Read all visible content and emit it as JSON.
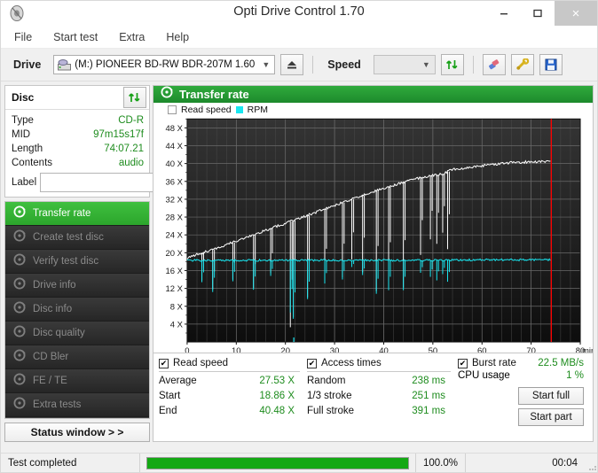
{
  "window": {
    "title": "Opti Drive Control 1.70",
    "app_icon": "disc-icon",
    "minimize": "–",
    "maximize": "□",
    "close": "×"
  },
  "menu": {
    "items": [
      {
        "label": "File"
      },
      {
        "label": "Start test"
      },
      {
        "label": "Extra"
      },
      {
        "label": "Help"
      }
    ]
  },
  "toolbar": {
    "drive_label": "Drive",
    "drive_value": "(M:)  PIONEER BD-RW   BDR-207M 1.60",
    "eject_icon": "eject-icon",
    "speed_label": "Speed",
    "speed_value": "",
    "refresh_icon": "refresh-arrows-icon",
    "eraser_icon": "eraser-icon",
    "tools_icon": "wrench-icon",
    "save_icon": "save-floppy-icon"
  },
  "disc": {
    "panel_title": "Disc",
    "refresh_icon": "refresh-arrows-icon",
    "rows": [
      {
        "key": "Type",
        "value": "CD-R"
      },
      {
        "key": "MID",
        "value": "97m15s17f"
      },
      {
        "key": "Length",
        "value": "74:07.21"
      },
      {
        "key": "Contents",
        "value": "audio"
      }
    ],
    "label_key": "Label",
    "label_value": "",
    "label_placeholder": "",
    "cd_icon": "cd-disc-icon"
  },
  "nav": {
    "items": [
      {
        "label": "Transfer rate",
        "icon": "disc-test-icon",
        "active": true
      },
      {
        "label": "Create test disc",
        "icon": "disc-test-icon",
        "active": false
      },
      {
        "label": "Verify test disc",
        "icon": "disc-test-icon",
        "active": false
      },
      {
        "label": "Drive info",
        "icon": "disc-test-icon",
        "active": false
      },
      {
        "label": "Disc info",
        "icon": "disc-test-icon",
        "active": false
      },
      {
        "label": "Disc quality",
        "icon": "disc-test-icon",
        "active": false
      },
      {
        "label": "CD Bler",
        "icon": "disc-test-icon",
        "active": false
      },
      {
        "label": "FE / TE",
        "icon": "disc-test-icon",
        "active": false
      },
      {
        "label": "Extra tests",
        "icon": "disc-test-icon",
        "active": false
      }
    ],
    "status_window_button": "Status window > >"
  },
  "chart_panel": {
    "header_title": "Transfer rate",
    "header_icon": "disc-test-icon"
  },
  "chart_data": {
    "type": "line",
    "title": "Transfer rate",
    "xlabel": "min",
    "ylabel": "X",
    "xlim": [
      0,
      80
    ],
    "ylim": [
      0,
      50
    ],
    "xticks": [
      0,
      10,
      20,
      30,
      40,
      50,
      60,
      70,
      80
    ],
    "xtick_labels": [
      "0",
      "10",
      "20",
      "30",
      "40",
      "50",
      "60",
      "70",
      "80"
    ],
    "x_unit_label": "min",
    "yticks": [
      4,
      8,
      12,
      16,
      20,
      24,
      28,
      32,
      36,
      40,
      44,
      48
    ],
    "ytick_labels": [
      "4 X",
      "8 X",
      "12 X",
      "16 X",
      "20 X",
      "24 X",
      "28 X",
      "32 X",
      "36 X",
      "40 X",
      "44 X",
      "48 X"
    ],
    "grid": true,
    "legend_position": "top-left",
    "plot_background": "#1a1a1a",
    "end_marker_x": 74.1,
    "end_marker_color": "#ff0000",
    "series": [
      {
        "name": "Read speed",
        "color": "#ffffff",
        "points": [
          [
            0.0,
            18.8
          ],
          [
            2.0,
            19.6
          ],
          [
            4.0,
            20.3
          ],
          [
            6.0,
            21.0
          ],
          [
            8.0,
            21.8
          ],
          [
            10.0,
            22.6
          ],
          [
            12.0,
            23.4
          ],
          [
            14.0,
            24.2
          ],
          [
            16.0,
            25.0
          ],
          [
            18.0,
            25.8
          ],
          [
            20.0,
            26.6
          ],
          [
            22.0,
            27.4
          ],
          [
            24.0,
            28.2
          ],
          [
            26.0,
            29.0
          ],
          [
            28.0,
            29.8
          ],
          [
            30.0,
            30.6
          ],
          [
            32.0,
            31.4
          ],
          [
            34.0,
            32.2
          ],
          [
            36.0,
            33.0
          ],
          [
            38.0,
            33.7
          ],
          [
            40.0,
            34.4
          ],
          [
            42.0,
            35.1
          ],
          [
            44.0,
            35.8
          ],
          [
            46.0,
            36.4
          ],
          [
            48.0,
            37.0
          ],
          [
            50.0,
            37.3
          ],
          [
            52.0,
            37.7
          ],
          [
            54.0,
            38.7
          ],
          [
            56.0,
            38.9
          ],
          [
            58.0,
            39.2
          ],
          [
            60.0,
            39.5
          ],
          [
            62.0,
            39.8
          ],
          [
            64.0,
            40.0
          ],
          [
            66.0,
            40.2
          ],
          [
            68.0,
            40.3
          ],
          [
            70.0,
            40.4
          ],
          [
            72.0,
            40.4
          ],
          [
            74.1,
            40.5
          ]
        ],
        "dropouts": [
          [
            3.0,
            13.8
          ],
          [
            5.2,
            11.8
          ],
          [
            9.3,
            14.0
          ],
          [
            13.5,
            12.1
          ],
          [
            17.0,
            15.4
          ],
          [
            21.0,
            3.3
          ],
          [
            21.6,
            5.6
          ],
          [
            24.5,
            10.0
          ],
          [
            28.0,
            13.6
          ],
          [
            31.6,
            14.5
          ],
          [
            33.5,
            18.5
          ],
          [
            35.7,
            15.6
          ],
          [
            38.5,
            11.4
          ],
          [
            41.0,
            12.2
          ],
          [
            44.0,
            12.2
          ],
          [
            47.5,
            19.5
          ],
          [
            49.5,
            23.0
          ],
          [
            50.8,
            22.0
          ],
          [
            52.0,
            24.5
          ],
          [
            53.0,
            20.8
          ]
        ]
      },
      {
        "name": "RPM",
        "color": "#19e6f0",
        "points": [
          [
            0.0,
            18.3
          ],
          [
            10.0,
            18.3
          ],
          [
            20.0,
            18.3
          ],
          [
            30.0,
            18.3
          ],
          [
            40.0,
            18.3
          ],
          [
            50.0,
            18.3
          ],
          [
            60.0,
            18.4
          ],
          [
            70.0,
            18.4
          ],
          [
            74.1,
            18.4
          ]
        ],
        "dropouts": [
          [
            3.0,
            13.4
          ],
          [
            5.2,
            11.2
          ],
          [
            9.3,
            13.6
          ],
          [
            13.5,
            11.7
          ],
          [
            17.0,
            14.8
          ],
          [
            21.0,
            6.6
          ],
          [
            21.6,
            5.2
          ],
          [
            24.5,
            9.6
          ],
          [
            28.0,
            13.1
          ],
          [
            31.6,
            14.0
          ],
          [
            33.5,
            16.8
          ],
          [
            35.7,
            15.0
          ],
          [
            38.5,
            10.8
          ],
          [
            41.0,
            11.6
          ],
          [
            44.0,
            11.6
          ],
          [
            47.5,
            15.5
          ],
          [
            49.5,
            14.6
          ],
          [
            50.8,
            13.8
          ],
          [
            52.0,
            15.2
          ],
          [
            53.0,
            13.5
          ]
        ]
      }
    ]
  },
  "stats": {
    "read_speed": {
      "check_label": "Read speed",
      "checked": true,
      "rows": [
        {
          "key": "Average",
          "value": "27.53 X"
        },
        {
          "key": "Start",
          "value": "18.86 X"
        },
        {
          "key": "End",
          "value": "40.48 X"
        }
      ]
    },
    "access_times": {
      "check_label": "Access times",
      "checked": true,
      "rows": [
        {
          "key": "Random",
          "value": "238 ms"
        },
        {
          "key": "1/3 stroke",
          "value": "251 ms"
        },
        {
          "key": "Full stroke",
          "value": "391 ms"
        }
      ]
    },
    "burst": {
      "check_label": "Burst rate",
      "checked": true,
      "burst_value": "22.5 MB/s",
      "cpu_key": "CPU usage",
      "cpu_value": "1 %",
      "start_full": "Start full",
      "start_part": "Start part"
    }
  },
  "statusbar": {
    "message": "Test completed",
    "progress_percent": 100.0,
    "progress_text": "100.0%",
    "elapsed": "00:04"
  },
  "colors": {
    "accent_green": "#1e8c1e",
    "header_green": "#2faa3c",
    "read_speed": "#ffffff",
    "rpm": "#19e6f0",
    "marker_red": "#ff0000",
    "plot_bg": "#1a1a1a"
  }
}
